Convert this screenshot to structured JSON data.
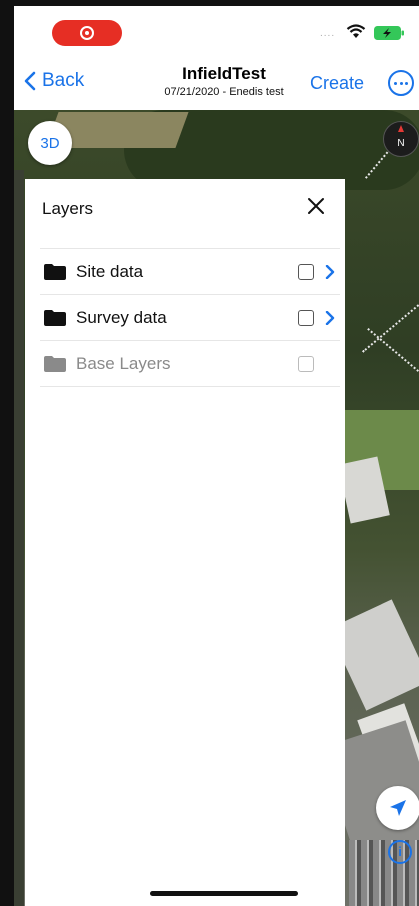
{
  "status_bar": {
    "signal": "....",
    "icons": [
      "record-icon",
      "wifi-icon",
      "battery-charging-icon"
    ]
  },
  "nav": {
    "back_label": "Back",
    "title": "InfieldTest",
    "subtitle": "07/21/2020 - Enedis test",
    "create_label": "Create",
    "icons": [
      "chevron-left-icon",
      "more-icon"
    ]
  },
  "map": {
    "toggle_3d_label": "3D",
    "compass_label": "N",
    "info_label": "i",
    "icons": [
      "compass-icon",
      "location-arrow-icon",
      "info-icon"
    ]
  },
  "layers_panel": {
    "title": "Layers",
    "close_icon": "close-icon",
    "items": [
      {
        "label": "Site data",
        "enabled": true,
        "checked": false,
        "has_children": true
      },
      {
        "label": "Survey data",
        "enabled": true,
        "checked": false,
        "has_children": true
      },
      {
        "label": "Base Layers",
        "enabled": false,
        "checked": false,
        "has_children": false
      }
    ]
  },
  "colors": {
    "accent": "#1a73e8",
    "record": "#e62e24",
    "disabled_text": "#8a8a8a",
    "battery": "#34c759"
  }
}
